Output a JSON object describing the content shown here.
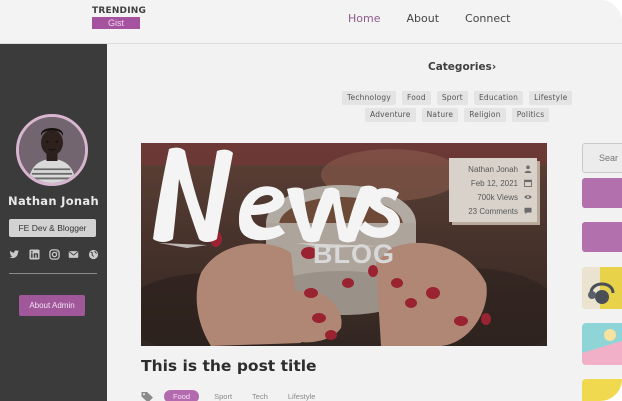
{
  "brand": {
    "line1": "TRENDING",
    "line2": "Gist"
  },
  "nav": {
    "home": "Home",
    "about": "About",
    "connect": "Connect"
  },
  "sidebar": {
    "author_name": "Nathan Jonah",
    "author_role": "FE Dev & Blogger",
    "about_button": "About Admin",
    "social_icons": [
      "twitter-icon",
      "linkedin-icon",
      "instagram-icon",
      "mail-icon",
      "globe-icon"
    ]
  },
  "categories": {
    "title": "Categories",
    "title_suffix": "›",
    "row1": [
      "Technology",
      "Food",
      "Sport",
      "Education",
      "Lifestyle"
    ],
    "row2": [
      "Adventure",
      "Nature",
      "Religion",
      "Politics"
    ]
  },
  "hero": {
    "headline": "News",
    "subheadline": "BLOG",
    "meta": {
      "author": "Nathan Jonah",
      "date": "Feb 12, 2021",
      "views": "700k Views",
      "comments": "23 Comments"
    }
  },
  "post": {
    "title": "This is the post title",
    "tags": [
      "Food",
      "Sport",
      "Tech",
      "Lifestyle"
    ]
  },
  "right_column": {
    "search_placeholder": "Sear"
  },
  "colors": {
    "accent": "#a0589a",
    "sidebar_bg": "#3b3b3b",
    "page_bg": "#f2f2f2"
  }
}
